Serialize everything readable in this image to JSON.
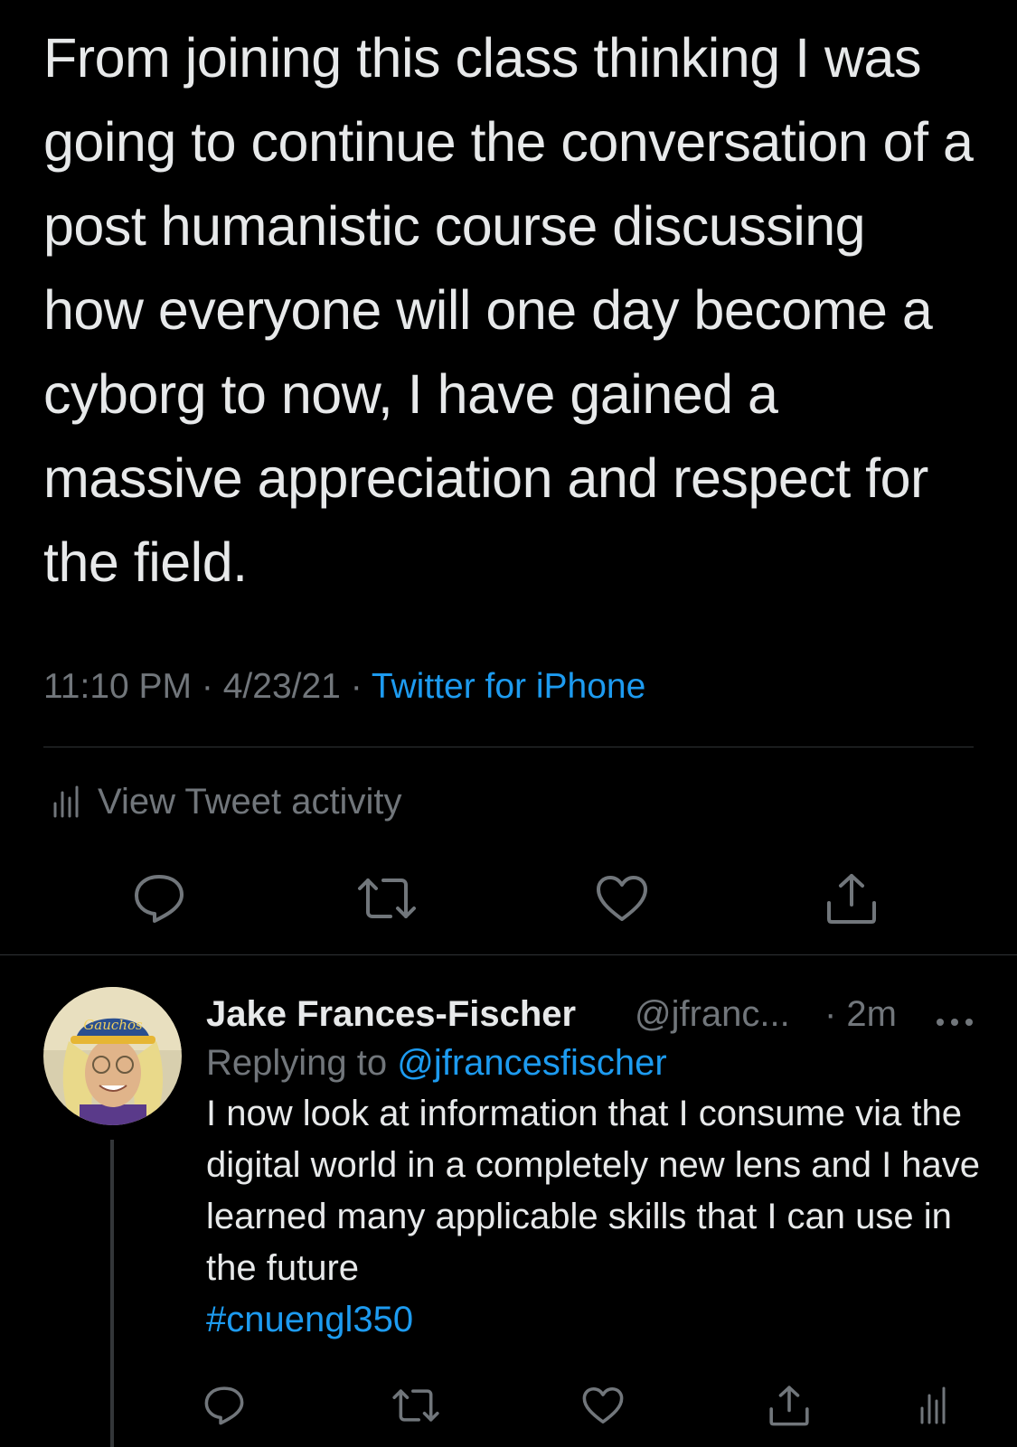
{
  "main_tweet": {
    "text": "From joining this class thinking I was going to continue the conversation of a post humanistic course discussing how everyone will one day become a cyborg to now, I have gained a massive appreciation and respect for the field.",
    "time": "11:10 PM",
    "separator": "·",
    "date": "4/23/21",
    "source": "Twitter for iPhone",
    "activity_label": "View Tweet activity"
  },
  "actions": {
    "icons": [
      "reply-icon",
      "retweet-icon",
      "like-icon",
      "share-icon"
    ]
  },
  "reply": {
    "name": "Jake Frances-Fischer",
    "handle": "@jfranc...",
    "time": "· 2m",
    "replying_prefix": "Replying to",
    "replying_to": "@jfrancesfischer",
    "text": "I now look at information that I consume via the digital world in a completely new lens and I have learned many applicable skills that I can use in the future",
    "hashtag": "#cnuengl350",
    "icons": [
      "reply-icon",
      "retweet-icon",
      "like-icon",
      "share-icon",
      "analytics-icon"
    ]
  },
  "colors": {
    "background": "#000000",
    "text": "#e7e9ea",
    "secondary": "#71767b",
    "accent": "#1d9bf0",
    "divider": "#2f3336"
  }
}
